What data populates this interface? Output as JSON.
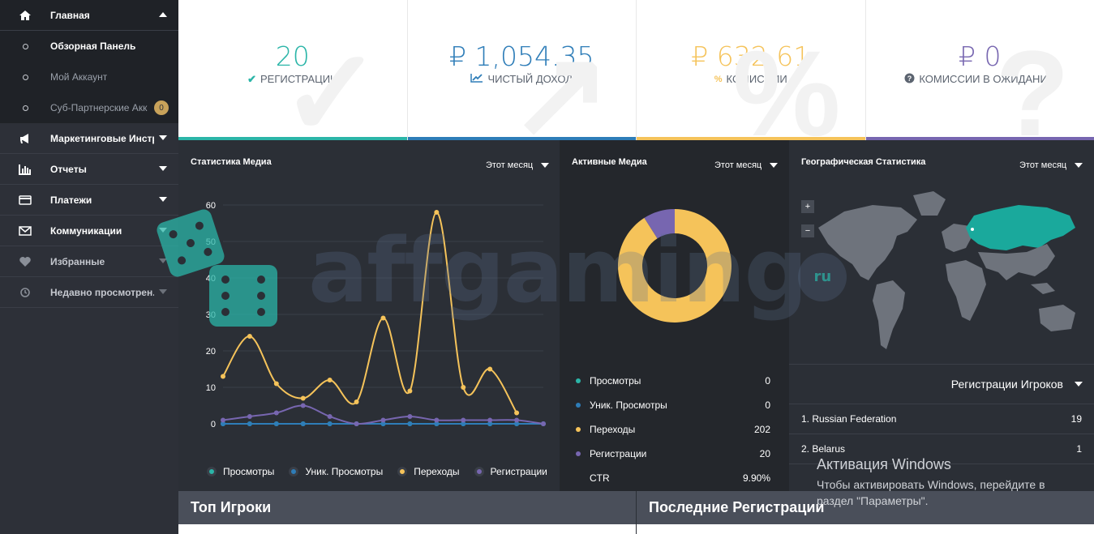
{
  "sidebar": {
    "items": [
      {
        "label": "Главная",
        "icon": "home-icon"
      },
      {
        "label": "Маркетинговые Инстр...",
        "icon": "megaphone-icon"
      },
      {
        "label": "Отчеты",
        "icon": "bar-chart-icon"
      },
      {
        "label": "Платежи",
        "icon": "credit-card-icon"
      },
      {
        "label": "Коммуникации",
        "icon": "envelope-icon"
      },
      {
        "label": "Избранные",
        "icon": "heart-icon"
      },
      {
        "label": "Недавно просмотрен...",
        "icon": "history-icon"
      }
    ],
    "subitems": [
      {
        "label": "Обзорная Панель"
      },
      {
        "label": "Мой Аккаунт"
      },
      {
        "label": "Суб-Партнерские Акк...",
        "badge": "0"
      }
    ]
  },
  "cards": [
    {
      "value": "20",
      "label": "РЕГИСТРАЦИИ",
      "color": "#2bb5a8",
      "icon": "check-icon"
    },
    {
      "value": "₽ 1,054.35",
      "label": "ЧИСТЫЙ ДОХОД",
      "color": "#2e7db8",
      "icon": "trend-chart-icon"
    },
    {
      "value": "₽ 632.61",
      "label": "КОМИССИИ",
      "color": "#f5c35a",
      "icon": "percent-icon"
    },
    {
      "value": "₽ 0",
      "label": "КОМИССИИ В ОЖИДАНИИ",
      "color": "#7766b0",
      "icon": "question-circle-icon"
    }
  ],
  "media_stats": {
    "title": "Статистика Медиа",
    "period": "Этот месяц"
  },
  "active_media": {
    "title": "Активные Медиа",
    "period": "Этот месяц",
    "rows": [
      {
        "name": "Просмотры",
        "value": "0",
        "color": "#2bb5a8"
      },
      {
        "name": "Уник. Просмотры",
        "value": "0",
        "color": "#2e7db8"
      },
      {
        "name": "Переходы",
        "value": "202",
        "color": "#f5c35a"
      },
      {
        "name": "Регистрации",
        "value": "20",
        "color": "#7766b0"
      },
      {
        "name": "CTR",
        "value": "9.90%",
        "color": ""
      }
    ]
  },
  "geo": {
    "title": "Географическая Статистика",
    "period": "Этот месяц",
    "zoom_in": "+",
    "zoom_out": "−"
  },
  "player_regs": {
    "title": "Регистрации Игроков",
    "rows": [
      {
        "name": "1. Russian Federation",
        "value": "19"
      },
      {
        "name": "2. Belarus",
        "value": "1"
      }
    ]
  },
  "bottom": {
    "top_players": "Топ Игроки",
    "last_regs": "Последние Регистрации"
  },
  "overlay": {
    "watermark": "affgaming",
    "watermark_badge": "ru",
    "activation_title": "Активация Windows",
    "activation_line1": "Чтобы активировать Windows, перейдите в",
    "activation_line2": "раздел \"Параметры\"."
  },
  "chart_data": {
    "type": "line",
    "x": [
      1,
      2,
      3,
      4,
      5,
      6,
      7,
      8,
      9,
      10,
      11,
      12,
      13
    ],
    "ylim": [
      0,
      60
    ],
    "yticks": [
      0,
      10,
      20,
      30,
      40,
      50,
      60
    ],
    "series": [
      {
        "name": "Просмотры",
        "color": "#2bb5a8",
        "values": [
          0,
          0,
          0,
          0,
          0,
          0,
          0,
          0,
          0,
          0,
          0,
          0,
          0
        ]
      },
      {
        "name": "Уник. Просмотры",
        "color": "#2e7db8",
        "values": [
          0,
          0,
          0,
          0,
          0,
          0,
          0,
          0,
          0,
          0,
          0,
          0,
          0
        ]
      },
      {
        "name": "Переходы",
        "color": "#f5c35a",
        "values": [
          13,
          24,
          11,
          7,
          12,
          6,
          29,
          9,
          58,
          10,
          15,
          3,
          null
        ]
      },
      {
        "name": "Регистрации",
        "color": "#7766b0",
        "values": [
          1,
          2,
          3,
          5,
          2,
          0,
          1,
          2,
          1,
          1,
          1,
          1,
          0
        ]
      }
    ]
  },
  "donut_data": {
    "type": "pie",
    "values": [
      202,
      20
    ],
    "colors": [
      "#f5c35a",
      "#7766b0"
    ]
  }
}
